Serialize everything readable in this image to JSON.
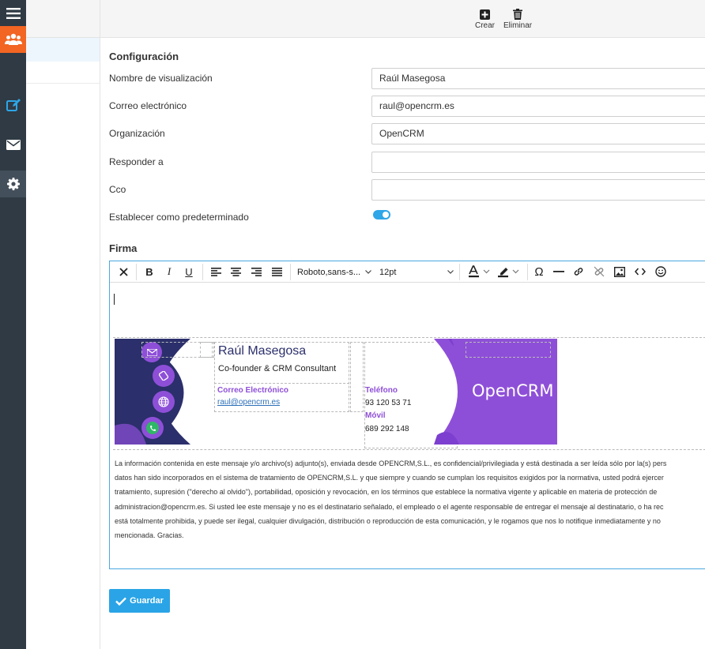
{
  "toolbar": {
    "create_label": "Crear",
    "delete_label": "Eliminar"
  },
  "form": {
    "section_title": "Configuración",
    "fields": [
      {
        "label": "Nombre de visualización",
        "value": "Raúl Masegosa"
      },
      {
        "label": "Correo electrónico",
        "value": "raul@opencrm.es"
      },
      {
        "label": "Organización",
        "value": "OpenCRM"
      },
      {
        "label": "Responder a",
        "value": ""
      },
      {
        "label": "Cco",
        "value": ""
      }
    ],
    "default_label": "Establecer como predeterminado",
    "default_on": true
  },
  "signature": {
    "section_title": "Firma",
    "font_family": "Roboto,sans-s...",
    "font_size": "12pt",
    "card": {
      "name": "Raúl Masegosa",
      "role": "Co-founder & CRM Consultant",
      "email_label": "Correo Electrónico",
      "email": "raul@opencrm.es",
      "phone_label": "Teléfono",
      "phone": "93 120 53 71",
      "mobile_label": "Móvil",
      "mobile": "689 292 148",
      "logo_text": "OpenCRM",
      "colors": {
        "navy": "#2b2f6b",
        "purple": "#8e4fd8",
        "green": "#2fb866"
      }
    },
    "legal_lines": [
      "La información contenida en este mensaje y/o archivo(s) adjunto(s), enviada desde OPENCRM,S.L., es confidencial/privilegiada y está destinada a ser leída sólo por la(s) pers",
      "datos han sido incorporados en el sistema de tratamiento de OPENCRM,S.L. y que siempre y cuando se cumplan los requisitos exigidos por la normativa, usted podrá ejercer",
      "tratamiento, supresión (\"derecho al olvido\"), portabilidad, oposición y revocación, en los términos que establece la normativa vigente y aplicable en materia de protección de",
      "administracion@opencrm.es. Si usted lee este mensaje y no es el destinatario señalado, el empleado o el agente responsable de entregar el mensaje al destinatario, o ha rec",
      "está totalmente prohibida, y puede ser ilegal, cualquier divulgación, distribución o reproducción de esta comunicación, y le rogamos que nos lo notifique inmediatamente y no",
      "mencionada. Gracias."
    ]
  },
  "save_label": "Guardar",
  "colors": {
    "accent": "#2aa4e6",
    "rail": "#2f3a44",
    "rail_active": "#f26522"
  }
}
